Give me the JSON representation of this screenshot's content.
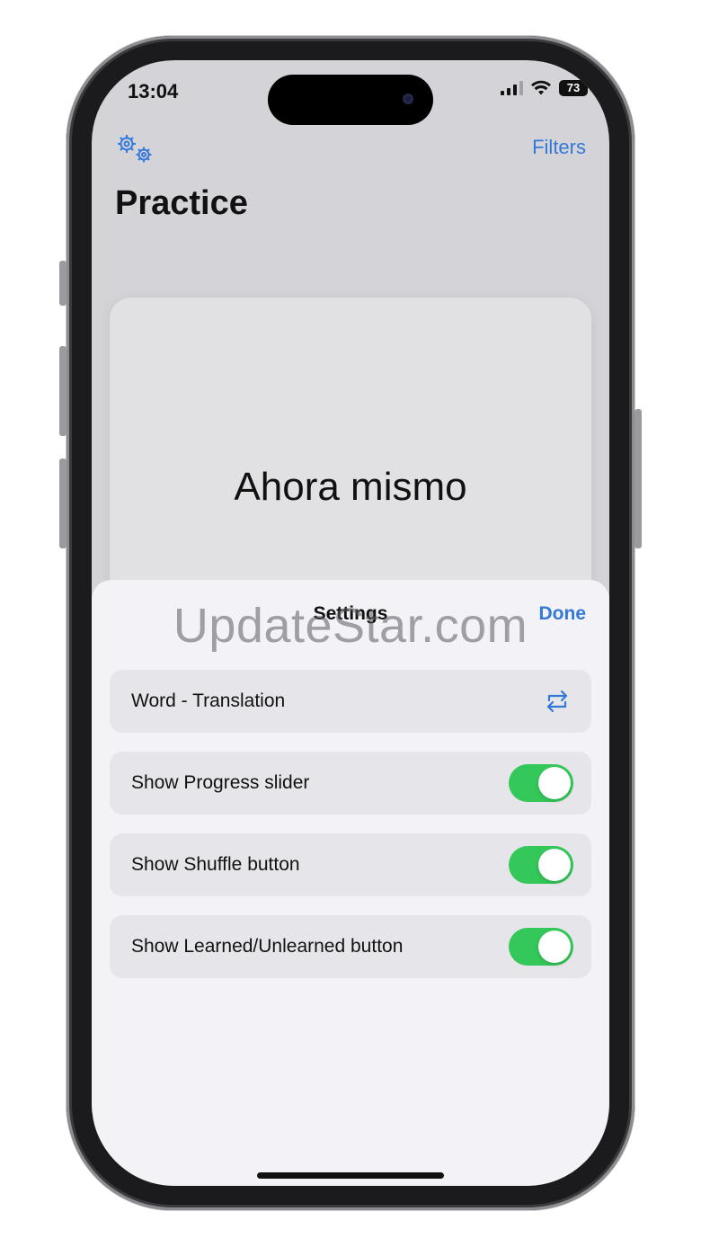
{
  "status_bar": {
    "time": "13:04",
    "battery": "73"
  },
  "nav": {
    "filters_label": "Filters",
    "title": "Practice"
  },
  "card": {
    "word": "Ahora mismo"
  },
  "sheet": {
    "title": "Settings",
    "done_label": "Done",
    "watermark": "UpdateStar.com",
    "rows": [
      {
        "label": "Word - Translation",
        "control": "swap-icon"
      },
      {
        "label": "Show Progress slider",
        "control": "toggle",
        "on": true
      },
      {
        "label": "Show Shuffle button",
        "control": "toggle",
        "on": true
      },
      {
        "label": "Show Learned/Unlearned button",
        "control": "toggle",
        "on": true
      }
    ]
  },
  "colors": {
    "accent": "#3478d8",
    "toggle_on": "#34c759",
    "sheet_bg": "#f2f2f7",
    "row_bg": "#e6e6ea"
  }
}
